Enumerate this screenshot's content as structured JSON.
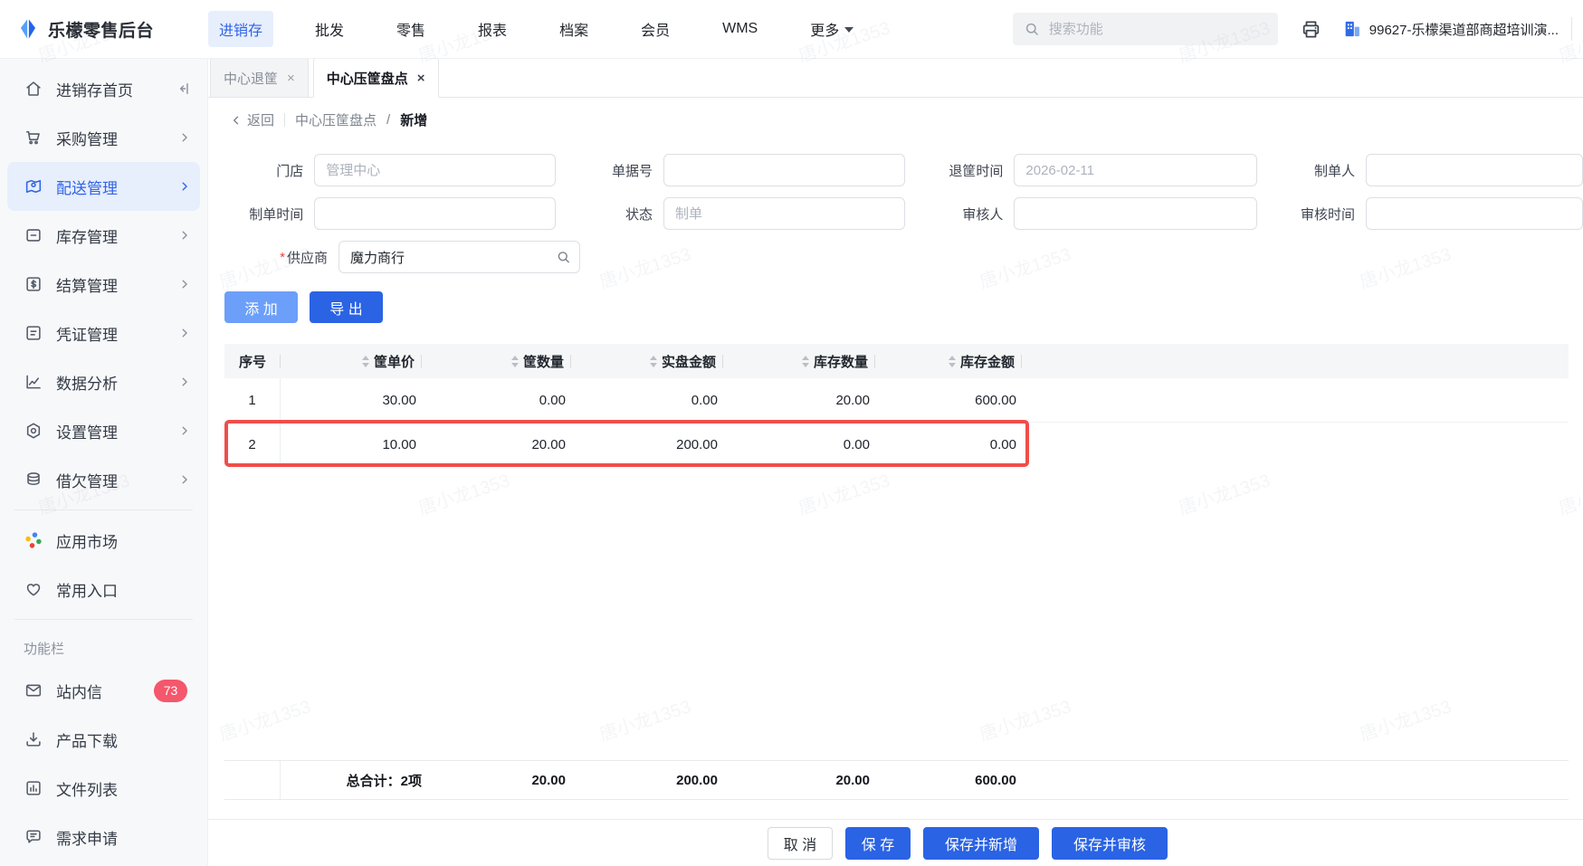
{
  "topbar": {
    "logo": "乐檬零售后台",
    "nav": [
      {
        "label": "进销存",
        "active": true
      },
      {
        "label": "批发",
        "active": false
      },
      {
        "label": "零售",
        "active": false
      },
      {
        "label": "报表",
        "active": false
      },
      {
        "label": "档案",
        "active": false
      },
      {
        "label": "会员",
        "active": false
      },
      {
        "label": "WMS",
        "active": false
      },
      {
        "label": "更多",
        "active": false,
        "caret": true
      }
    ],
    "search_placeholder": "搜索功能",
    "company": "99627-乐檬渠道部商超培训演..."
  },
  "sidebar": {
    "items": [
      {
        "label": "进销存首页",
        "icon": "home-icon",
        "active": false,
        "trailing": "collapse"
      },
      {
        "label": "采购管理",
        "icon": "cart-icon",
        "active": false,
        "trailing": "chevron"
      },
      {
        "label": "配送管理",
        "icon": "delivery-map-icon",
        "active": true,
        "trailing": "chevron"
      },
      {
        "label": "库存管理",
        "icon": "inventory-box-icon",
        "active": false,
        "trailing": "chevron"
      },
      {
        "label": "结算管理",
        "icon": "settlement-icon",
        "active": false,
        "trailing": "chevron"
      },
      {
        "label": "凭证管理",
        "icon": "voucher-icon",
        "active": false,
        "trailing": "chevron"
      },
      {
        "label": "数据分析",
        "icon": "analytics-icon",
        "active": false,
        "trailing": "chevron"
      },
      {
        "label": "设置管理",
        "icon": "settings-icon",
        "active": false,
        "trailing": "chevron"
      },
      {
        "label": "借欠管理",
        "icon": "debt-icon",
        "active": false,
        "trailing": "chevron"
      }
    ],
    "shortcuts": [
      {
        "label": "应用市场",
        "icon": "app-market-icon"
      },
      {
        "label": "常用入口",
        "icon": "heart-icon"
      }
    ],
    "section_label": "功能栏",
    "tools": [
      {
        "label": "站内信",
        "icon": "mail-icon",
        "badge": "73"
      },
      {
        "label": "产品下载",
        "icon": "download-icon"
      },
      {
        "label": "文件列表",
        "icon": "file-list-icon"
      },
      {
        "label": "需求申请",
        "icon": "request-icon"
      }
    ]
  },
  "tabs": [
    {
      "label": "中心退筐",
      "active": false
    },
    {
      "label": "中心压筐盘点",
      "active": true
    }
  ],
  "breadcrumb": {
    "back": "返回",
    "parent": "中心压筐盘点",
    "current": "新增"
  },
  "form": {
    "rows": [
      [
        {
          "label": "门店",
          "name": "store-field",
          "placeholder": "管理中心"
        },
        {
          "label": "单据号",
          "name": "doc-no-field",
          "placeholder": ""
        },
        {
          "label": "退筐时间",
          "name": "return-date-field",
          "placeholder": "2026-02-11"
        },
        {
          "label": "制单人",
          "name": "creator-field",
          "placeholder": ""
        }
      ],
      [
        {
          "label": "制单时间",
          "name": "create-time-field",
          "placeholder": ""
        },
        {
          "label": "状态",
          "name": "status-field",
          "placeholder": "制单"
        },
        {
          "label": "审核人",
          "name": "auditor-field",
          "placeholder": ""
        },
        {
          "label": "审核时间",
          "name": "audit-time-field",
          "placeholder": ""
        }
      ],
      [
        {
          "label": "供应商",
          "name": "supplier-field",
          "required": true,
          "value": "魔力商行",
          "search_icon": true
        }
      ]
    ]
  },
  "toolbar": {
    "add": "添 加",
    "export": "导 出"
  },
  "table": {
    "columns": [
      {
        "label": "序号",
        "sortable": false
      },
      {
        "label": "筐单价",
        "sortable": true
      },
      {
        "label": "筐数量",
        "sortable": true
      },
      {
        "label": "实盘金额",
        "sortable": true
      },
      {
        "label": "库存数量",
        "sortable": true
      },
      {
        "label": "库存金额",
        "sortable": true
      }
    ],
    "rows": [
      {
        "cells": [
          "1",
          "30.00",
          "0.00",
          "0.00",
          "20.00",
          "600.00"
        ],
        "highlighted": false
      },
      {
        "cells": [
          "2",
          "10.00",
          "20.00",
          "200.00",
          "0.00",
          "0.00"
        ],
        "highlighted": true
      }
    ],
    "totals": {
      "label": "总合计：2项",
      "values": [
        "20.00",
        "200.00",
        "20.00",
        "600.00"
      ]
    }
  },
  "footer": {
    "cancel": "取 消",
    "save": "保 存",
    "save_new": "保存并新增",
    "save_audit": "保存并审核"
  },
  "colors": {
    "primary": "#2a63e4",
    "primary_light": "#6c9ff9",
    "active_blue": "#3065e6",
    "highlight_red": "#f04e4a",
    "badge_red": "#f5576c"
  },
  "watermark": "唐小龙1353"
}
